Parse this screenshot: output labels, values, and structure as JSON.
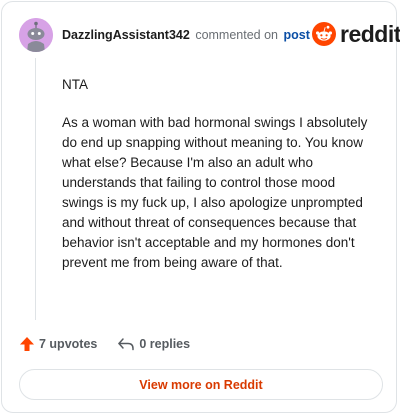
{
  "header": {
    "author": "DazzlingAssistant342",
    "action_text": "commented on",
    "post_link": "post"
  },
  "brand": {
    "logo_text": "reddit",
    "logo_color": "#ff4500"
  },
  "comment": {
    "paragraphs": [
      "NTA",
      "As a woman with bad hormonal swings I absolutely do end up snapping without meaning to. You know what else? Because I'm also an adult who understands that failing to control those mood swings is my fuck up, I also apologize unprompted and without threat of consequences because that behavior isn't acceptable and my hormones don't prevent me from being aware of that."
    ]
  },
  "actions": {
    "upvotes": "7 upvotes",
    "replies": "0 replies"
  },
  "footer": {
    "view_more": "View more on Reddit"
  },
  "icons": {
    "avatar": "snoo-avatar-icon",
    "logo": "reddit-snoo-icon",
    "upvote": "upvote-arrow-icon",
    "reply": "reply-arrow-icon"
  },
  "colors": {
    "upvote": "#ff4500",
    "view_more_text": "#d93a00",
    "avatar_bg": "#d7a2e6",
    "post_link": "#0a4ea5"
  }
}
